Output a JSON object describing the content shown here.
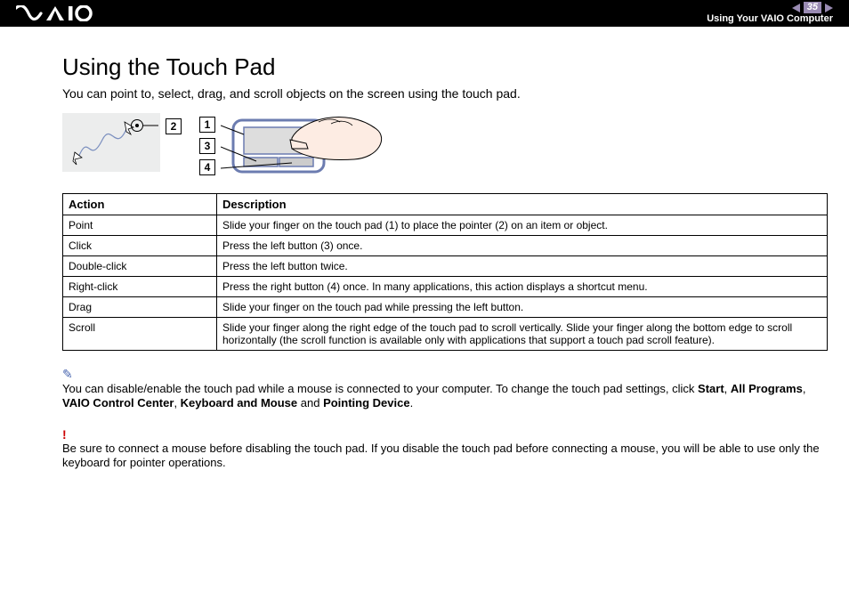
{
  "header": {
    "page_number": "35",
    "section": "Using Your VAIO Computer"
  },
  "title": "Using the Touch Pad",
  "intro": "You can point to, select, drag, and scroll objects on the screen using the touch pad.",
  "labels": {
    "n1": "1",
    "n2": "2",
    "n3": "3",
    "n4": "4"
  },
  "table": {
    "headers": {
      "action": "Action",
      "description": "Description"
    },
    "rows": [
      {
        "action": "Point",
        "description": "Slide your finger on the touch pad (1) to place the pointer (2) on an item or object."
      },
      {
        "action": "Click",
        "description": "Press the left button (3) once."
      },
      {
        "action": "Double-click",
        "description": "Press the left button twice."
      },
      {
        "action": "Right-click",
        "description": "Press the right button (4) once. In many applications, this action displays a shortcut menu."
      },
      {
        "action": "Drag",
        "description": "Slide your finger on the touch pad while pressing the left button."
      },
      {
        "action": "Scroll",
        "description": "Slide your finger along the right edge of the touch pad to scroll vertically. Slide your finger along the bottom edge to scroll horizontally (the scroll function is available only with applications that support a touch pad scroll feature)."
      }
    ]
  },
  "note1": {
    "pre": "You can disable/enable the touch pad while a mouse is connected to your computer. To change the touch pad settings, click ",
    "b1": "Start",
    "s1": ", ",
    "b2": "All Programs",
    "s2": ", ",
    "b3": "VAIO Control Center",
    "s3": ", ",
    "b4": "Keyboard and Mouse",
    "s4": " and ",
    "b5": "Pointing Device",
    "post": "."
  },
  "warn": "!",
  "note2": "Be sure to connect a mouse before disabling the touch pad. If you disable the touch pad before connecting a mouse, you will be able to use only the keyboard for pointer operations."
}
